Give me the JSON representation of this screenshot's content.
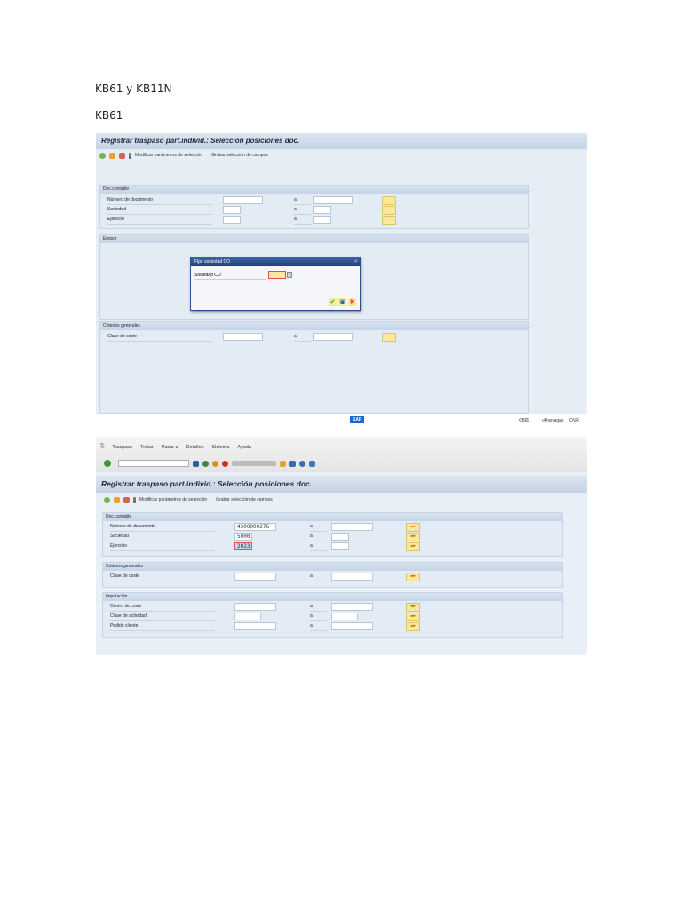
{
  "document": {
    "heading1": "KB61 y KB11N",
    "heading2": "KB61"
  },
  "shot1": {
    "title": "Registrar traspaso part.individ.: Selección posiciones doc.",
    "toolbar": {
      "modify": "Modificar parámetros de selección",
      "save_sel": "Grabar selección de campos"
    },
    "sections": {
      "doc": {
        "header": "Doc.contable",
        "rows": [
          {
            "label": "Número de documento",
            "to": "a"
          },
          {
            "label": "Sociedad",
            "to": "a"
          },
          {
            "label": "Ejercicio",
            "to": "a"
          }
        ]
      },
      "emisor": {
        "header": "Emisor"
      },
      "criterios": {
        "header": "Criterios generales",
        "rows": [
          {
            "label": "Clase de coste",
            "to": "a"
          }
        ]
      }
    },
    "dialog": {
      "title": "Fijar sociedad CO",
      "field_label": "Sociedad CO",
      "close": "×"
    },
    "status": {
      "logo": "SAP",
      "tcode": "KB61",
      "system": "s4hanaqas",
      "mode": "OVR"
    }
  },
  "shot2": {
    "menu": [
      "Traspaso",
      "Tratar",
      "Pasar a",
      "Detalles",
      "Sistema",
      "Ayuda"
    ],
    "title": "Registrar traspaso part.individ.: Selección posiciones doc.",
    "toolbar": {
      "modify": "Modificar parámetros de selección",
      "save_sel": "Grabar selección de campos"
    },
    "sections": {
      "doc": {
        "header": "Doc.contable",
        "rows": [
          {
            "label": "Número de documento",
            "value": "4300000276",
            "to": "a"
          },
          {
            "label": "Sociedad",
            "value": "5000",
            "to": "a"
          },
          {
            "label": "Ejercicio",
            "value": "2023",
            "to": "a"
          }
        ]
      },
      "criterios": {
        "header": "Criterios generales",
        "rows": [
          {
            "label": "Clase de coste",
            "to": "a"
          }
        ]
      },
      "imputacion": {
        "header": "Imputación",
        "rows": [
          {
            "label": "Centro de coste",
            "to": "a"
          },
          {
            "label": "Clase de actividad",
            "to": "a"
          },
          {
            "label": "Pedido cliente",
            "to": "a"
          }
        ]
      }
    }
  }
}
